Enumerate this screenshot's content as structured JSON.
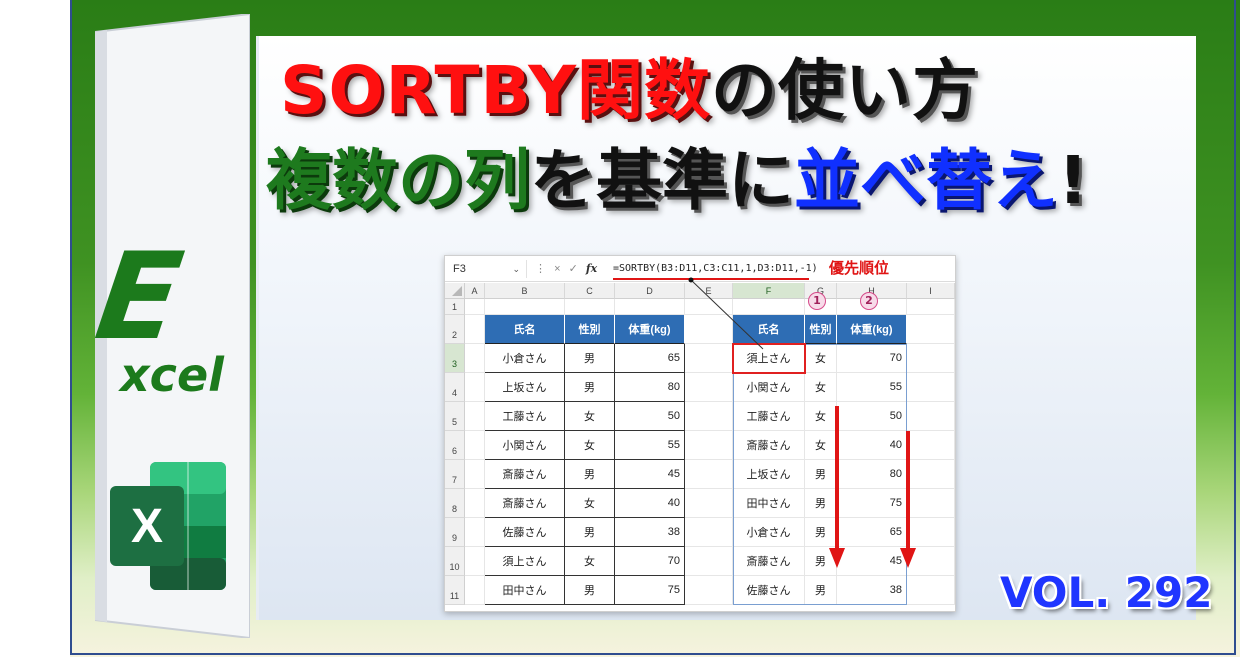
{
  "title": {
    "line1_red": "SORTBY関数",
    "line1_black": "の使い方",
    "line2_green": "複数の列",
    "line2_black1": "を基準に",
    "line2_blue": "並べ替え",
    "line2_black2": "!"
  },
  "cover": {
    "letter": "E",
    "word": "xcel",
    "logo_letter": "X"
  },
  "formula_bar": {
    "name_box": "F3",
    "name_box_dropdown": "⌄",
    "fx_label": "fx",
    "cancel_icon": "×",
    "enter_icon": "✓",
    "more_icon": "⋮",
    "formula": "=SORTBY(B3:D11,C3:C11,1,D3:D11,-1)",
    "priority_label": "優先順位"
  },
  "columns": [
    "A",
    "B",
    "C",
    "D",
    "E",
    "F",
    "G",
    "H",
    "I"
  ],
  "rows": [
    "1",
    "2",
    "3",
    "4",
    "5",
    "6",
    "7",
    "8",
    "9",
    "10",
    "11"
  ],
  "source_table": {
    "headers": [
      "氏名",
      "性別",
      "体重(kg)"
    ],
    "rows": [
      [
        "小倉さん",
        "男",
        "65"
      ],
      [
        "上坂さん",
        "男",
        "80"
      ],
      [
        "工藤さん",
        "女",
        "50"
      ],
      [
        "小関さん",
        "女",
        "55"
      ],
      [
        "斎藤さん",
        "男",
        "45"
      ],
      [
        "斎藤さん",
        "女",
        "40"
      ],
      [
        "佐藤さん",
        "男",
        "38"
      ],
      [
        "須上さん",
        "女",
        "70"
      ],
      [
        "田中さん",
        "男",
        "75"
      ]
    ]
  },
  "sorted_table": {
    "headers": [
      "氏名",
      "性別",
      "体重(kg)"
    ],
    "rows": [
      [
        "須上さん",
        "女",
        "70"
      ],
      [
        "小関さん",
        "女",
        "55"
      ],
      [
        "工藤さん",
        "女",
        "50"
      ],
      [
        "斎藤さん",
        "女",
        "40"
      ],
      [
        "上坂さん",
        "男",
        "80"
      ],
      [
        "田中さん",
        "男",
        "75"
      ],
      [
        "小倉さん",
        "男",
        "65"
      ],
      [
        "斎藤さん",
        "男",
        "45"
      ],
      [
        "佐藤さん",
        "男",
        "38"
      ]
    ]
  },
  "priority_markers": [
    "1",
    "2"
  ],
  "volume": "VOL. 292",
  "colors": {
    "title_red": "#ff1010",
    "title_green": "#1e7a1e",
    "title_blue": "#1030ff",
    "header_blue": "#2e6db4",
    "arrow_red": "#e01515",
    "excel_green": "#1d6f42"
  }
}
